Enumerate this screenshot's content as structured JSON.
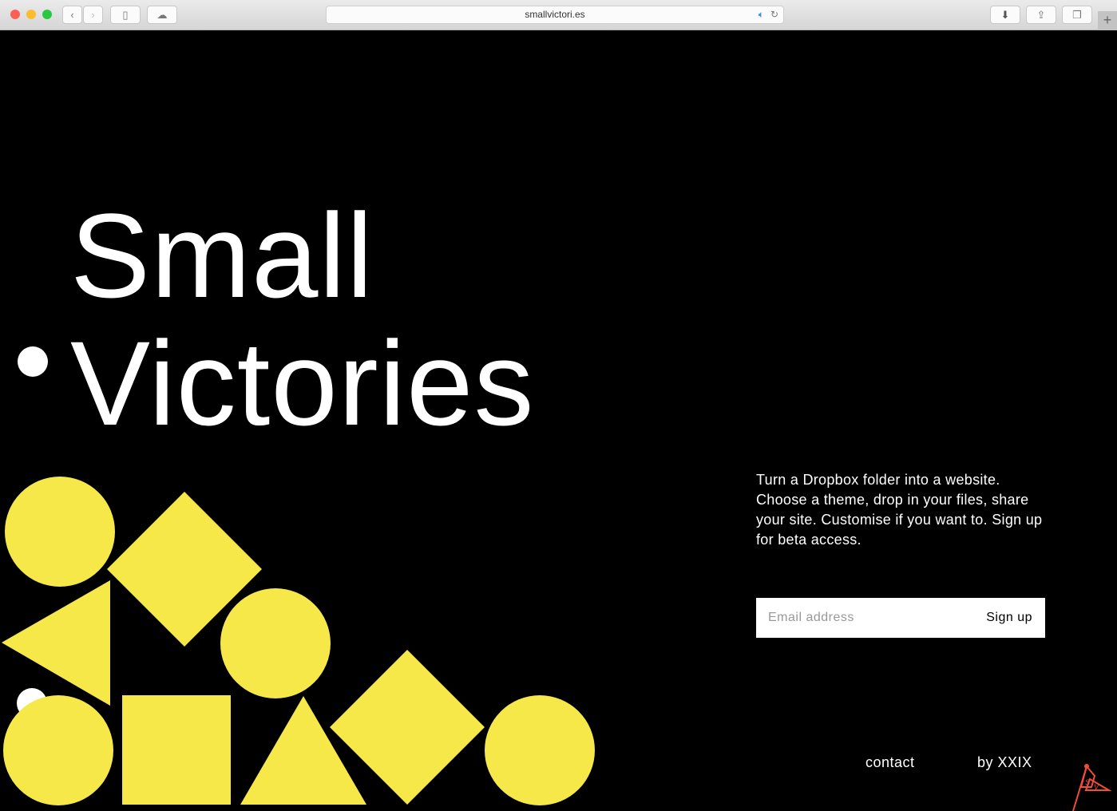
{
  "browser": {
    "url": "smallvictori.es",
    "icons": [
      "back-icon",
      "forward-icon",
      "sidebar-icon",
      "cloud-icon",
      "audio-icon",
      "reload-icon",
      "download-icon",
      "share-icon",
      "tabs-icon",
      "new-tab-icon"
    ]
  },
  "hero": {
    "line1": "Small",
    "line2": "Victories"
  },
  "description": "Turn a Dropbox folder into a website. Choose a theme, drop in your files, share your site. Customise if you want to. Sign up for beta access.",
  "signup": {
    "placeholder": "Email address",
    "button": "Sign up"
  },
  "footer": {
    "contact": "contact",
    "credit": "by XXIX"
  },
  "logo": {
    "letters": "SV"
  },
  "colors": {
    "background": "#000000",
    "shapes": "#f7e84a",
    "logo": "#f04e37"
  }
}
